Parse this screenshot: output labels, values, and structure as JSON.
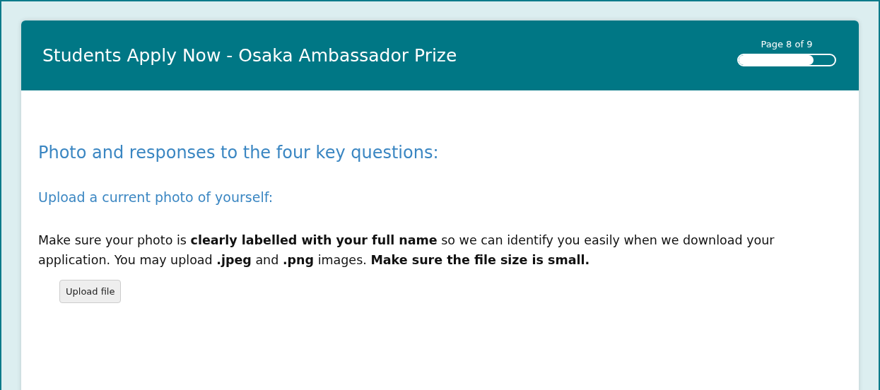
{
  "header": {
    "title": "Students Apply Now - Osaka Ambassador Prize",
    "page_indicator": "Page 8 of 9",
    "progress": {
      "level": 0.78
    }
  },
  "section_heading": "Photo and responses to the four key questions:",
  "question": {
    "label": "Upload a current photo of yourself:",
    "instructions": "Make sure your photo is **clearly labelled with your full name** so we can identify you easily when we download your application. You may upload **.jpeg** and **.png** images. **Make sure the file size is small.**",
    "button": "Upload file"
  }
}
